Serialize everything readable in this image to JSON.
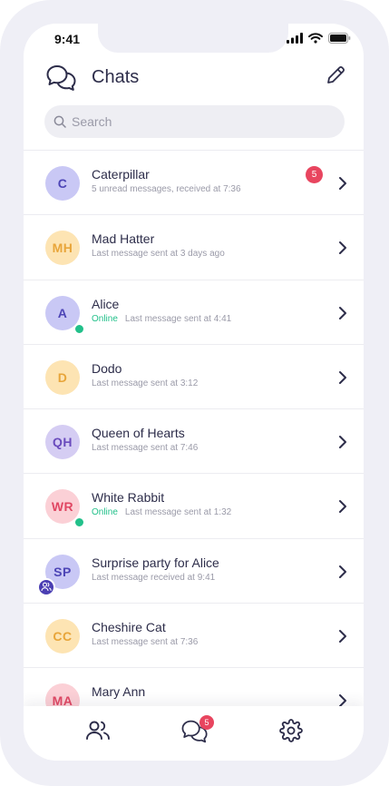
{
  "status_bar": {
    "time": "9:41"
  },
  "header": {
    "title": "Chats"
  },
  "search": {
    "placeholder": "Search"
  },
  "chats": [
    {
      "initials": "C",
      "name": "Caterpillar",
      "subtitle": "5 unread messages, received at 7:36",
      "online": "",
      "unread": "5",
      "avatar_bg": "#c9c8f5",
      "avatar_fg": "#4d45b6"
    },
    {
      "initials": "MH",
      "name": "Mad Hatter",
      "subtitle": "Last message sent at 3 days ago",
      "online": "",
      "unread": "",
      "avatar_bg": "#fde4b3",
      "avatar_fg": "#e8a53a"
    },
    {
      "initials": "A",
      "name": "Alice",
      "subtitle": "Last message sent at 4:41",
      "online": "Online",
      "unread": "",
      "avatar_bg": "#c9c8f5",
      "avatar_fg": "#4d45b6"
    },
    {
      "initials": "D",
      "name": "Dodo",
      "subtitle": "Last message sent at 3:12",
      "online": "",
      "unread": "",
      "avatar_bg": "#fde4b3",
      "avatar_fg": "#e8a53a"
    },
    {
      "initials": "QH",
      "name": "Queen of Hearts",
      "subtitle": "Last message sent at 7:46",
      "online": "",
      "unread": "",
      "avatar_bg": "#d5cdf3",
      "avatar_fg": "#6a4bbd"
    },
    {
      "initials": "WR",
      "name": "White Rabbit",
      "subtitle": "Last message sent at 1:32",
      "online": "Online",
      "unread": "",
      "avatar_bg": "#fbd0d6",
      "avatar_fg": "#e04763"
    },
    {
      "initials": "SP",
      "name": "Surprise party for Alice",
      "subtitle": "Last message received at 9:41",
      "online": "",
      "unread": "",
      "avatar_bg": "#c9c8f5",
      "avatar_fg": "#4d45b6",
      "group": true
    },
    {
      "initials": "CC",
      "name": "Cheshire Cat",
      "subtitle": "Last message sent at 7:36",
      "online": "",
      "unread": "",
      "avatar_bg": "#fde4b3",
      "avatar_fg": "#e8a53a"
    },
    {
      "initials": "MA",
      "name": "Mary Ann",
      "subtitle": "",
      "online": "",
      "unread": "",
      "avatar_bg": "#fbd0d6",
      "avatar_fg": "#e04763"
    }
  ],
  "tabbar": {
    "chats_badge": "5"
  },
  "colors": {
    "accent": "#4d45b6",
    "online": "#22c08a",
    "badge": "#e8455f"
  }
}
